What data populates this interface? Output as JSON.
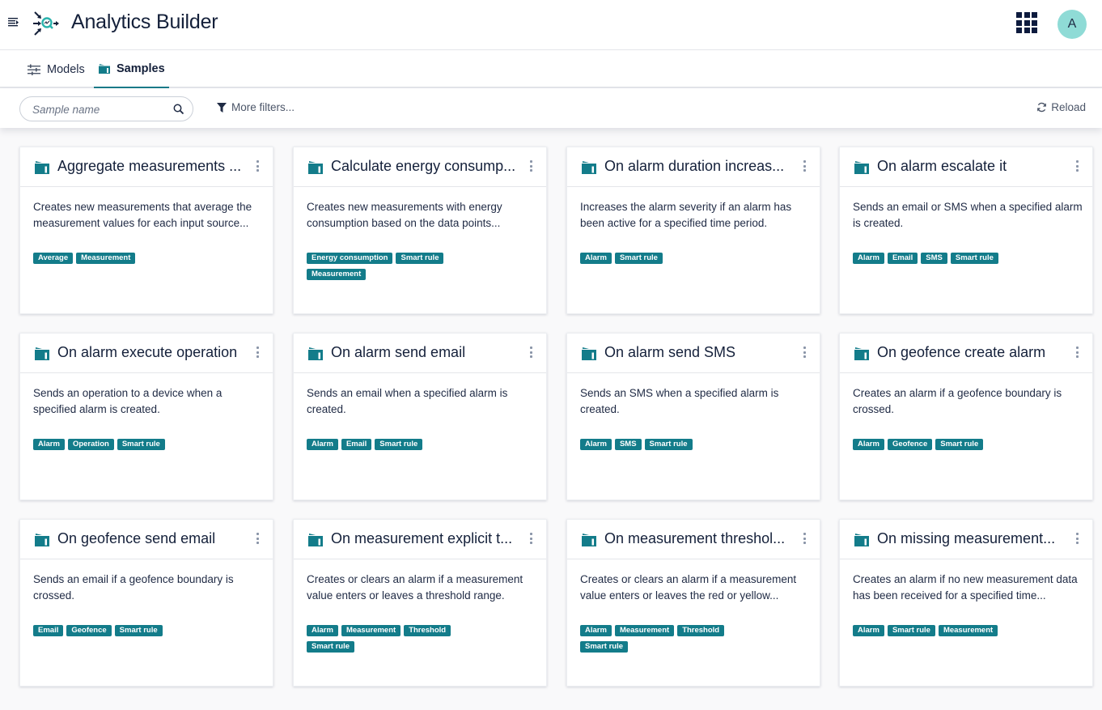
{
  "header": {
    "title": "Analytics Builder",
    "avatar_initial": "A",
    "icons": {
      "menu": "menu-toggle-icon",
      "logo": "analytics-builder-logo-icon",
      "apps": "app-switcher-grid-icon"
    }
  },
  "tabs": [
    {
      "label": "Models",
      "icon": "sliders-icon",
      "active": false
    },
    {
      "label": "Samples",
      "icon": "folder-icon",
      "active": true
    }
  ],
  "filterbar": {
    "search_placeholder": "Sample name",
    "search_value": "",
    "more_filters_label": "More filters...",
    "reload_label": "Reload"
  },
  "colors": {
    "accent": "#137c8a",
    "avatar_bg": "#8fdbd6",
    "text_dark": "#14203a"
  },
  "samples": [
    {
      "title": "Aggregate measurements ...",
      "description": "Creates new measurements that average the measurement values for each input source...",
      "tags": [
        "Average",
        "Measurement"
      ]
    },
    {
      "title": "Calculate energy consump...",
      "description": "Creates new measurements with energy consumption based on the data points...",
      "tags": [
        "Energy consumption",
        "Smart rule",
        "Measurement"
      ]
    },
    {
      "title": "On alarm duration increas...",
      "description": "Increases the alarm severity if an alarm has been active for a specified time period.",
      "tags": [
        "Alarm",
        "Smart rule"
      ]
    },
    {
      "title": "On alarm escalate it",
      "description": "Sends an email or SMS when a specified alarm is created.",
      "tags": [
        "Alarm",
        "Email",
        "SMS",
        "Smart rule"
      ]
    },
    {
      "title": "On alarm execute operation",
      "description": "Sends an operation to a device when a specified alarm is created.",
      "tags": [
        "Alarm",
        "Operation",
        "Smart rule"
      ]
    },
    {
      "title": "On alarm send email",
      "description": "Sends an email when a specified alarm is created.",
      "tags": [
        "Alarm",
        "Email",
        "Smart rule"
      ]
    },
    {
      "title": "On alarm send SMS",
      "description": "Sends an SMS when a specified alarm is created.",
      "tags": [
        "Alarm",
        "SMS",
        "Smart rule"
      ]
    },
    {
      "title": "On geofence create alarm",
      "description": "Creates an alarm if a geofence boundary is crossed.",
      "tags": [
        "Alarm",
        "Geofence",
        "Smart rule"
      ]
    },
    {
      "title": "On geofence send email",
      "description": "Sends an email if a geofence boundary is crossed.",
      "tags": [
        "Email",
        "Geofence",
        "Smart rule"
      ]
    },
    {
      "title": "On measurement explicit t...",
      "description": "Creates or clears an alarm if a measurement value enters or leaves a threshold range.",
      "tags": [
        "Alarm",
        "Measurement",
        "Threshold",
        "Smart rule"
      ]
    },
    {
      "title": "On measurement threshol...",
      "description": "Creates or clears an alarm if a measurement value enters or leaves the red or yellow...",
      "tags": [
        "Alarm",
        "Measurement",
        "Threshold",
        "Smart rule"
      ]
    },
    {
      "title": "On missing measurement...",
      "description": "Creates an alarm if no new measurement data has been received for a specified time...",
      "tags": [
        "Alarm",
        "Smart rule",
        "Measurement"
      ]
    }
  ]
}
